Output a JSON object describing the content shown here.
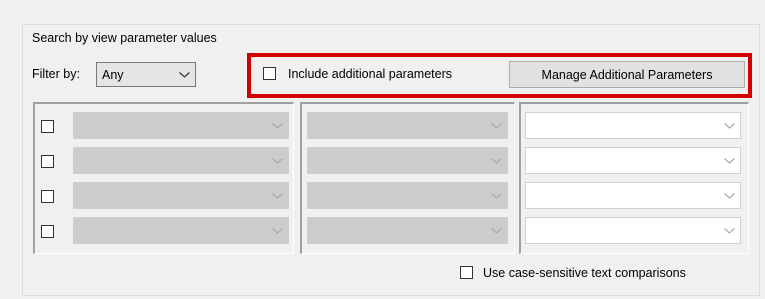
{
  "group": {
    "title": "Search by view parameter values"
  },
  "filter": {
    "label": "Filter by:",
    "value": "Any"
  },
  "include": {
    "label": "Include additional parameters",
    "checked": false
  },
  "manage_button": {
    "label": "Manage Additional Parameters"
  },
  "highlight_color": "#d40000",
  "rows": [
    {
      "checked": false,
      "parameter": "",
      "operator": "",
      "value": ""
    },
    {
      "checked": false,
      "parameter": "",
      "operator": "",
      "value": ""
    },
    {
      "checked": false,
      "parameter": "",
      "operator": "",
      "value": ""
    },
    {
      "checked": false,
      "parameter": "",
      "operator": "",
      "value": ""
    }
  ],
  "case_sensitive": {
    "label": "Use case-sensitive text comparisons",
    "checked": false
  },
  "icons": {
    "dropdown": "chevron-down-icon"
  }
}
